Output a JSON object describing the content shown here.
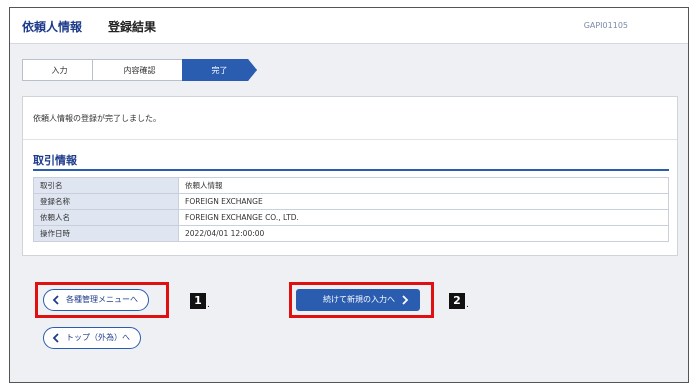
{
  "header": {
    "title": "依頼人情報",
    "subtitle": "登録結果",
    "screen_id": "GAPI01105"
  },
  "steps": [
    {
      "label": "入力"
    },
    {
      "label": "内容確認"
    },
    {
      "label": "完了"
    }
  ],
  "message": "依頼人情報の登録が完了しました。",
  "section": {
    "title": "取引情報",
    "rows": [
      {
        "key": "取引名",
        "value": "依頼人情報"
      },
      {
        "key": "登録名称",
        "value": "FOREIGN EXCHANGE"
      },
      {
        "key": "依頼人名",
        "value": "FOREIGN EXCHANGE CO., LTD."
      },
      {
        "key": "操作日時",
        "value": "2022/04/01 12:00:00"
      }
    ]
  },
  "buttons": {
    "menu_label": "各種管理メニューへ",
    "top_label": "トップ（外為）へ",
    "continue_label": "続けて新規の入力へ"
  },
  "annotations": {
    "n1": "1",
    "n2": "2"
  },
  "colors": {
    "accent": "#2a5db0",
    "title": "#1e3c8c",
    "highlight": "#e01010"
  }
}
